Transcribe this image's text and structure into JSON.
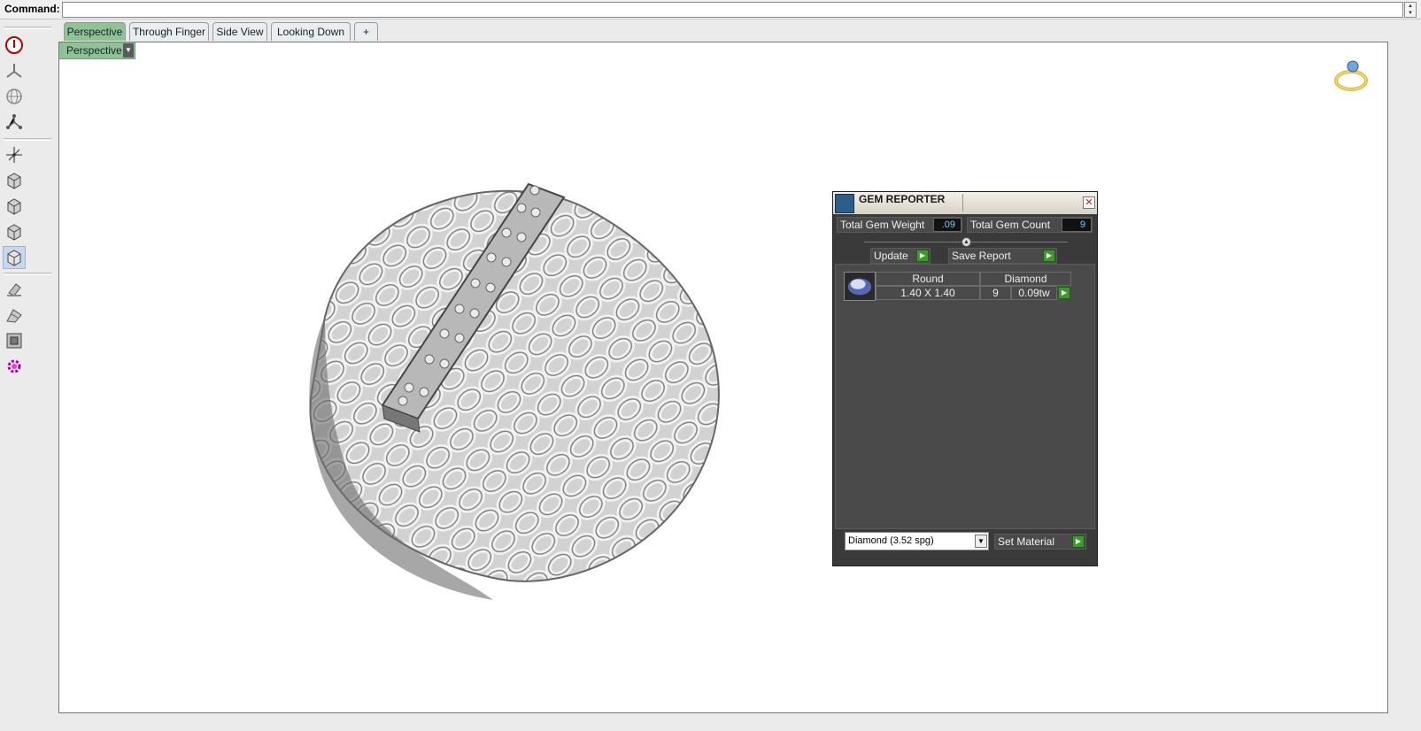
{
  "command_bar": {
    "label": "Command:",
    "value": ""
  },
  "toolbar": {
    "buttons": [
      {
        "name": "power-icon"
      },
      {
        "name": "triad-icon"
      },
      {
        "name": "globe-icon"
      },
      {
        "name": "node-icon"
      },
      {
        "name": "axes-icon"
      },
      {
        "name": "cube-view-icon"
      },
      {
        "name": "cube-view-icon"
      },
      {
        "name": "cube-view-icon"
      },
      {
        "name": "cube-view-icon"
      },
      {
        "name": "eraser-icon"
      },
      {
        "name": "paint-icon"
      },
      {
        "name": "frame-icon"
      },
      {
        "name": "gear-icon"
      }
    ],
    "selected_index": 8
  },
  "tabs": [
    {
      "label": "Perspective",
      "active": true
    },
    {
      "label": "Through Finger",
      "active": false
    },
    {
      "label": "Side View",
      "active": false
    },
    {
      "label": "Looking Down",
      "active": false
    },
    {
      "label": "+",
      "active": false
    }
  ],
  "viewport": {
    "title": "Perspective"
  },
  "gem_reporter": {
    "title": "GEM REPORTER",
    "total_weight_label": "Total Gem Weight",
    "total_weight_value": ".09",
    "total_count_label": "Total Gem Count",
    "total_count_value": "9",
    "update_label": "Update",
    "save_report_label": "Save Report",
    "rows": [
      {
        "shape": "Round",
        "size": "1.40 X 1.40",
        "material": "Diamond",
        "count": "9",
        "weight": "0.09tw"
      }
    ],
    "material_select": "Diamond     (3.52 spg)",
    "set_material_label": "Set Material"
  },
  "colors": {
    "tab_active": "#8fc393",
    "go_button": "#3c9a2d",
    "value_text": "#6fd0ff"
  }
}
